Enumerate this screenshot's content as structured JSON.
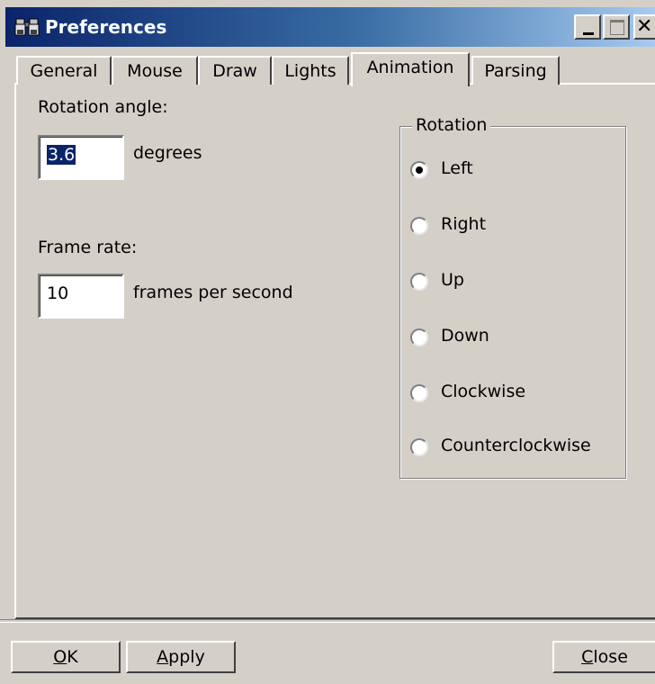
{
  "window": {
    "title": "Preferences",
    "icon": "binoculars-icon"
  },
  "tabs": [
    {
      "label": "General",
      "active": false
    },
    {
      "label": "Mouse",
      "active": false
    },
    {
      "label": "Draw",
      "active": false
    },
    {
      "label": "Lights",
      "active": false
    },
    {
      "label": "Animation",
      "active": true
    },
    {
      "label": "Parsing",
      "active": false
    }
  ],
  "animation": {
    "rotation_angle_label": "Rotation angle:",
    "rotation_angle_value": "3.6",
    "rotation_angle_unit": "degrees",
    "frame_rate_label": "Frame rate:",
    "frame_rate_value": "10",
    "frame_rate_unit": "frames per second",
    "rotation_group_label": "Rotation",
    "rotation_options": [
      {
        "label": "Left",
        "checked": true
      },
      {
        "label": "Right",
        "checked": false
      },
      {
        "label": "Up",
        "checked": false
      },
      {
        "label": "Down",
        "checked": false
      },
      {
        "label": "Clockwise",
        "checked": false
      },
      {
        "label": "Counterclockwise",
        "checked": false
      }
    ]
  },
  "buttons": {
    "ok": {
      "mnemonic": "O",
      "rest": "K"
    },
    "apply": {
      "mnemonic": "A",
      "rest": "pply"
    },
    "close": {
      "mnemonic": "C",
      "rest": "lose"
    }
  },
  "colors": {
    "title_bar_start": "#0a246a",
    "title_bar_end": "#a6caf0",
    "dialog_background": "#d4d0c8",
    "selection": "#0a246a"
  }
}
